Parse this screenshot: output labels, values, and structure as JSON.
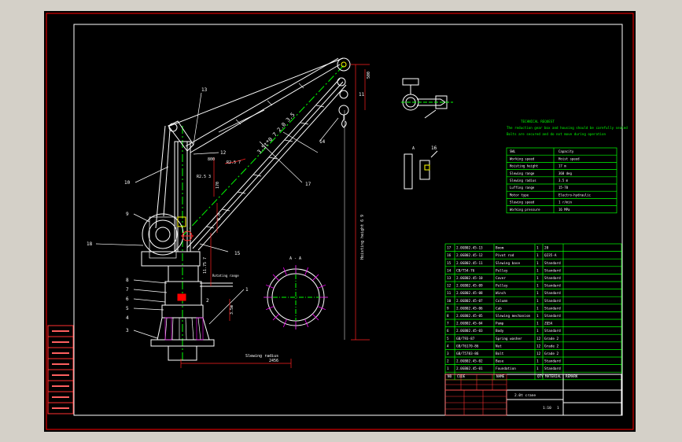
{
  "colors": {
    "viewport_bg": "#d4d0c8",
    "sheet": "#000000",
    "border": "#ff0000",
    "outline": "#ffffff",
    "center": "#00ff00",
    "dim": "#ff2020",
    "table": "#00ff00",
    "text": "#ffffff",
    "hatch": "#ff00ff",
    "accent": "#ffff00"
  },
  "callouts": [
    "13",
    "12",
    "11",
    "10",
    "9",
    "18",
    "8",
    "7",
    "6",
    "5",
    "4",
    "3",
    "2",
    "1",
    "14",
    "15",
    "16",
    "17"
  ],
  "dims": {
    "d1": "500",
    "d2": "800",
    "d3": "2456",
    "d4": "170",
    "d5": "R2.5 7",
    "d6": "R2.5 3",
    "d7": "8.0",
    "d8": "3.5m",
    "d9": "11.75 7"
  },
  "boom_text": "3.5t*0 7 2.0 3.5",
  "labels": {
    "section_a": "A - A",
    "view_a": "A",
    "slewing_radius": "Slewing radius",
    "height_label": "Hoisting height 6 9",
    "slewing_range": "Rotating range"
  },
  "tech_req": {
    "title": "TECHNICAL REQUEST",
    "line1": "The reduction gear box and housing should be carefully sealed",
    "line2": "Bolts are secured and do not move during operation"
  },
  "params": [
    [
      "SWL",
      "Capacity"
    ],
    [
      "Working speed",
      "Hoist speed"
    ],
    [
      "Hoisting height",
      "17 m"
    ],
    [
      "Slewing range",
      "360 deg"
    ],
    [
      "Slewing radius",
      "3.5 m"
    ],
    [
      "Luffing range",
      "15-70"
    ],
    [
      "Motor type",
      "Electro-hydraulic"
    ],
    [
      "Slewing speed",
      "1 r/min"
    ],
    [
      "Working pressure",
      "16 MPa"
    ]
  ],
  "bom": [
    [
      "17",
      "2.0GB02.45-13",
      "Boom",
      "1",
      "20"
    ],
    [
      "16",
      "2.0GB02.45-12",
      "Pivot rod",
      "1",
      "Q235-A"
    ],
    [
      "15",
      "2.0GB02.45-11",
      "Slewing base",
      "1",
      "Standard"
    ],
    [
      "14",
      "CB/T54-76",
      "Pulley",
      "1",
      "Standard"
    ],
    [
      "13",
      "2.0GB02.45-10",
      "Cover",
      "1",
      "Standard"
    ],
    [
      "12",
      "2.0GB02.45-09",
      "Pulley",
      "1",
      "Standard"
    ],
    [
      "11",
      "2.0GB02.45-08",
      "Winch",
      "1",
      "Standard"
    ],
    [
      "10",
      "2.0GB02.45-07",
      "Column",
      "1",
      "Standard"
    ],
    [
      "9",
      "2.0GB02.45-06",
      "Cab",
      "1",
      "Standard"
    ],
    [
      "8",
      "2.0GB02.45-05",
      "Slewing mechanism",
      "1",
      "Standard"
    ],
    [
      "7",
      "2.0GB02.45-04",
      "Pump",
      "1",
      "ZQ5A"
    ],
    [
      "6",
      "2.0GB02.45-03",
      "Body",
      "1",
      "Standard"
    ],
    [
      "5",
      "GB/T93-87",
      "Spring washer",
      "12",
      "Grade 2"
    ],
    [
      "4",
      "GB/T6170-86",
      "Nut",
      "12",
      "Grade 2"
    ],
    [
      "3",
      "GB/T5783-86",
      "Bolt",
      "12",
      "Grade 2"
    ],
    [
      "2",
      "2.0GB02.45-02",
      "Base",
      "1",
      "Standard"
    ],
    [
      "1",
      "2.0GB02.45-01",
      "Foundation",
      "1",
      "Standard"
    ]
  ],
  "bom_header": [
    "NO",
    "CODE",
    "NAME",
    "QTY",
    "MATERIAL",
    "REMARK"
  ],
  "title_block": {
    "name": "2.0t crane",
    "scale": "1:10",
    "sheet": "1"
  },
  "left_stamps": [
    "",
    "",
    "",
    "",
    "",
    "",
    "",
    ""
  ]
}
